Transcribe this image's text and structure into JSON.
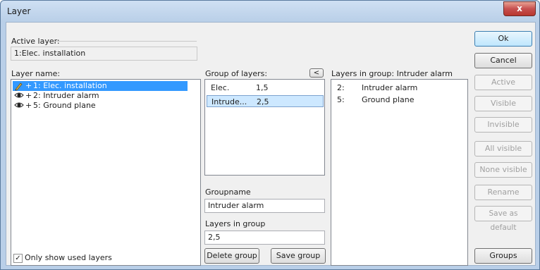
{
  "window": {
    "title": "Layer",
    "close_glyph": "x"
  },
  "active_layer": {
    "label": "Active layer:",
    "value": "1:Elec. installation"
  },
  "layer_name": {
    "label": "Layer name:",
    "items": [
      {
        "prefix": "+",
        "text": "1: Elec. installation",
        "icon": "pencil-icon",
        "selected": true
      },
      {
        "prefix": "+",
        "text": "2: Intruder alarm",
        "icon": "eye-icon",
        "selected": false
      },
      {
        "prefix": "+",
        "text": "5: Ground plane",
        "icon": "eye-icon",
        "selected": false
      }
    ]
  },
  "group_of_layers": {
    "label": "Group of layers:",
    "rows": [
      {
        "name": "Elec.",
        "layers": "1,5",
        "selected": false
      },
      {
        "name": "Intrude...",
        "layers": "2,5",
        "selected": true
      }
    ]
  },
  "move_left_button": "<",
  "layers_in_group_list": {
    "label": "Layers in group: Intruder alarm",
    "rows": [
      {
        "num": "2:",
        "name": "Intruder alarm"
      },
      {
        "num": "5:",
        "name": "Ground plane"
      }
    ]
  },
  "groupname": {
    "label": "Groupname",
    "value": "Intruder alarm"
  },
  "layers_in_group_field": {
    "label": "Layers in group",
    "value": "2,5"
  },
  "only_show_used": {
    "label": "Only show used layers",
    "checked": true,
    "check_glyph": "✓"
  },
  "buttons": {
    "ok": "Ok",
    "cancel": "Cancel",
    "active": "Active",
    "visible": "Visible",
    "invisible": "Invisible",
    "all_visible": "All visible",
    "none_visible": "None visible",
    "rename": "Rename",
    "save_as_default": "Save as default",
    "groups": "Groups",
    "delete_group": "Delete group",
    "save_group": "Save group"
  },
  "colors": {
    "selection": "#3399ff",
    "group_selection": "#cde8ff",
    "close_button": "#c75050"
  }
}
